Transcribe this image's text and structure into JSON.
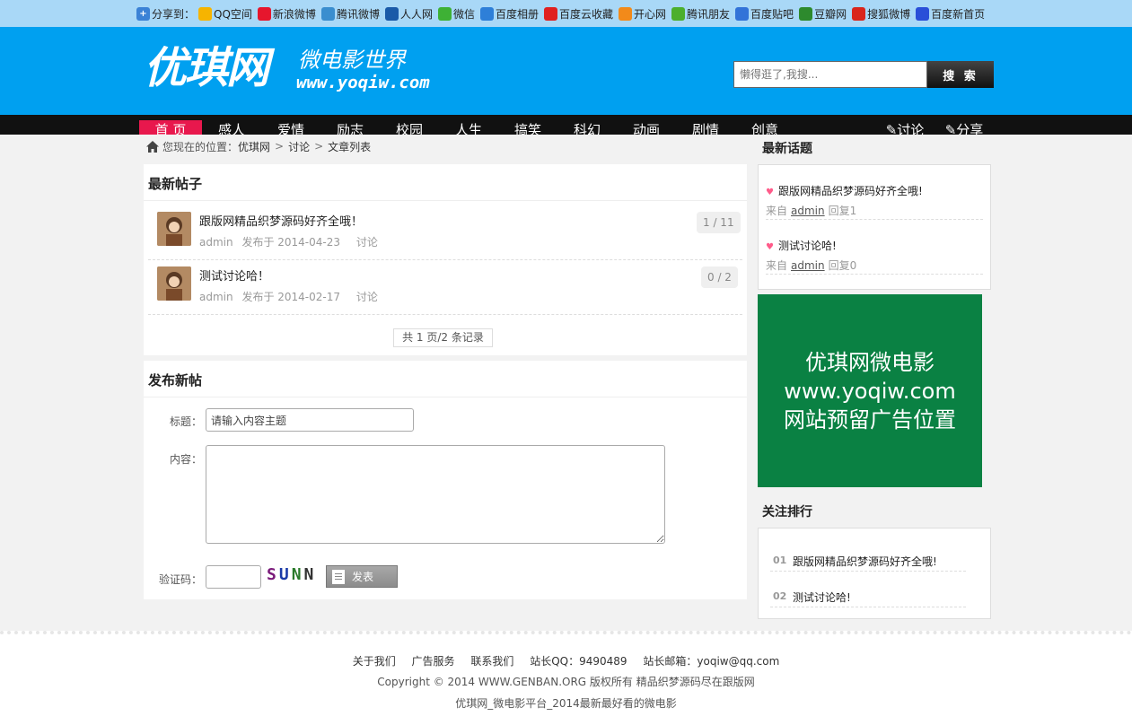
{
  "share": {
    "label": "分享到：",
    "items": [
      {
        "label": "QQ空间",
        "icon": "qzone-icon",
        "color": "#f6b400"
      },
      {
        "label": "新浪微博",
        "icon": "weibo-icon",
        "color": "#e6162d"
      },
      {
        "label": "腾讯微博",
        "icon": "tencent-weibo-icon",
        "color": "#3a8ecf"
      },
      {
        "label": "人人网",
        "icon": "renren-icon",
        "color": "#1a5aa8"
      },
      {
        "label": "微信",
        "icon": "wechat-icon",
        "color": "#3eb135"
      },
      {
        "label": "百度相册",
        "icon": "baidu-album-icon",
        "color": "#2e7fd8"
      },
      {
        "label": "百度云收藏",
        "icon": "baidu-cloud-fav-icon",
        "color": "#e02020"
      },
      {
        "label": "开心网",
        "icon": "kaixin-icon",
        "color": "#f28a1a"
      },
      {
        "label": "腾讯朋友",
        "icon": "tencent-friend-icon",
        "color": "#4caf2d"
      },
      {
        "label": "百度贴吧",
        "icon": "tieba-icon",
        "color": "#3273d8"
      },
      {
        "label": "豆瓣网",
        "icon": "douban-icon",
        "color": "#2d8a2d"
      },
      {
        "label": "搜狐微博",
        "icon": "sohu-weibo-icon",
        "color": "#d9251c"
      },
      {
        "label": "百度新首页",
        "icon": "baidu-home-icon",
        "color": "#2a4fd8"
      }
    ]
  },
  "header": {
    "logo_main": "优琪网",
    "logo_sub": "微电影世界",
    "logo_url": "www.yoqiw.com",
    "search_placeholder": "懒得逛了,我搜...",
    "search_button": "搜 索"
  },
  "nav": {
    "items": [
      "首 页",
      "感人",
      "爱情",
      "励志",
      "校园",
      "人生",
      "搞笑",
      "科幻",
      "动画",
      "剧情",
      "创意"
    ],
    "right": [
      "讨论",
      "分享"
    ]
  },
  "breadcrumb": {
    "prefix": "您现在的位置：",
    "items": [
      "优琪网",
      "讨论",
      "文章列表"
    ],
    "separator": ">"
  },
  "posts": {
    "title": "最新帖子",
    "items": [
      {
        "title": "跟版网精品织梦源码好齐全哦！",
        "author": "admin",
        "date": "发布于 2014-04-23",
        "category": "讨论",
        "count": "1 / 11"
      },
      {
        "title": "测试讨论哈！",
        "author": "admin",
        "date": "发布于 2014-02-17",
        "category": "讨论",
        "count": "0 / 2"
      }
    ],
    "pager": "共 1 页/2 条记录"
  },
  "form": {
    "title": "发布新帖",
    "subject_label": "标题：",
    "subject_value": "请输入内容主题",
    "content_label": "内容：",
    "captcha_label": "验证码：",
    "captcha_chars": [
      "S",
      "U",
      "N",
      "N"
    ],
    "submit": "发表"
  },
  "sidebar": {
    "topics_title": "最新话题",
    "topics": [
      {
        "title": "跟版网精品织梦源码好齐全哦!",
        "from": "来自",
        "author": "admin",
        "reply": "回复1"
      },
      {
        "title": "测试讨论哈!",
        "from": "来自",
        "author": "admin",
        "reply": "回复0"
      }
    ],
    "ad_lines": [
      "优琪网微电影",
      "www.yoqiw.com",
      "网站预留广告位置"
    ],
    "rank_title": "关注排行",
    "rank": [
      {
        "num": "01",
        "title": "跟版网精品织梦源码好齐全哦!"
      },
      {
        "num": "02",
        "title": "测试讨论哈!"
      }
    ]
  },
  "footer": {
    "links": [
      "关于我们",
      "广告服务",
      "联系我们",
      "站长QQ：9490489",
      "站长邮箱：yoqiw@qq.com"
    ],
    "copyright": "Copyright © 2014 WWW.GENBAN.ORG 版权所有 精品织梦源码尽在跟版网",
    "tagline": "优琪网_微电影平台_2014最新最好看的微电影"
  },
  "colors": {
    "header_bg": "#00a0f0",
    "share_bg": "#a9d8f7",
    "nav_bg": "#111111",
    "nav_active": "#e8184d",
    "ad_bg": "#0a8143"
  }
}
